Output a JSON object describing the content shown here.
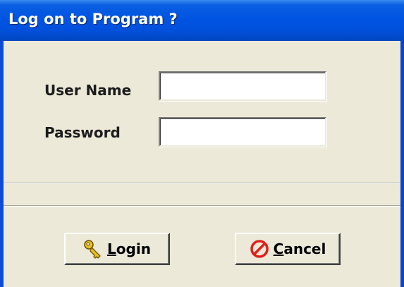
{
  "window": {
    "title": "Log on to Program ?"
  },
  "form": {
    "username_label": "User Name",
    "username_value": "",
    "password_label": "Password",
    "password_value": ""
  },
  "buttons": {
    "login": {
      "mnemonic": "L",
      "rest": "ogin",
      "icon": "key-icon"
    },
    "cancel": {
      "mnemonic": "C",
      "rest": "ancel",
      "icon": "no-entry-icon"
    }
  },
  "colors": {
    "titlebar": "#0054E3",
    "window_bg": "#ECE9D8",
    "cancel_icon": "#E0201A",
    "key_icon": "#E8C020"
  }
}
